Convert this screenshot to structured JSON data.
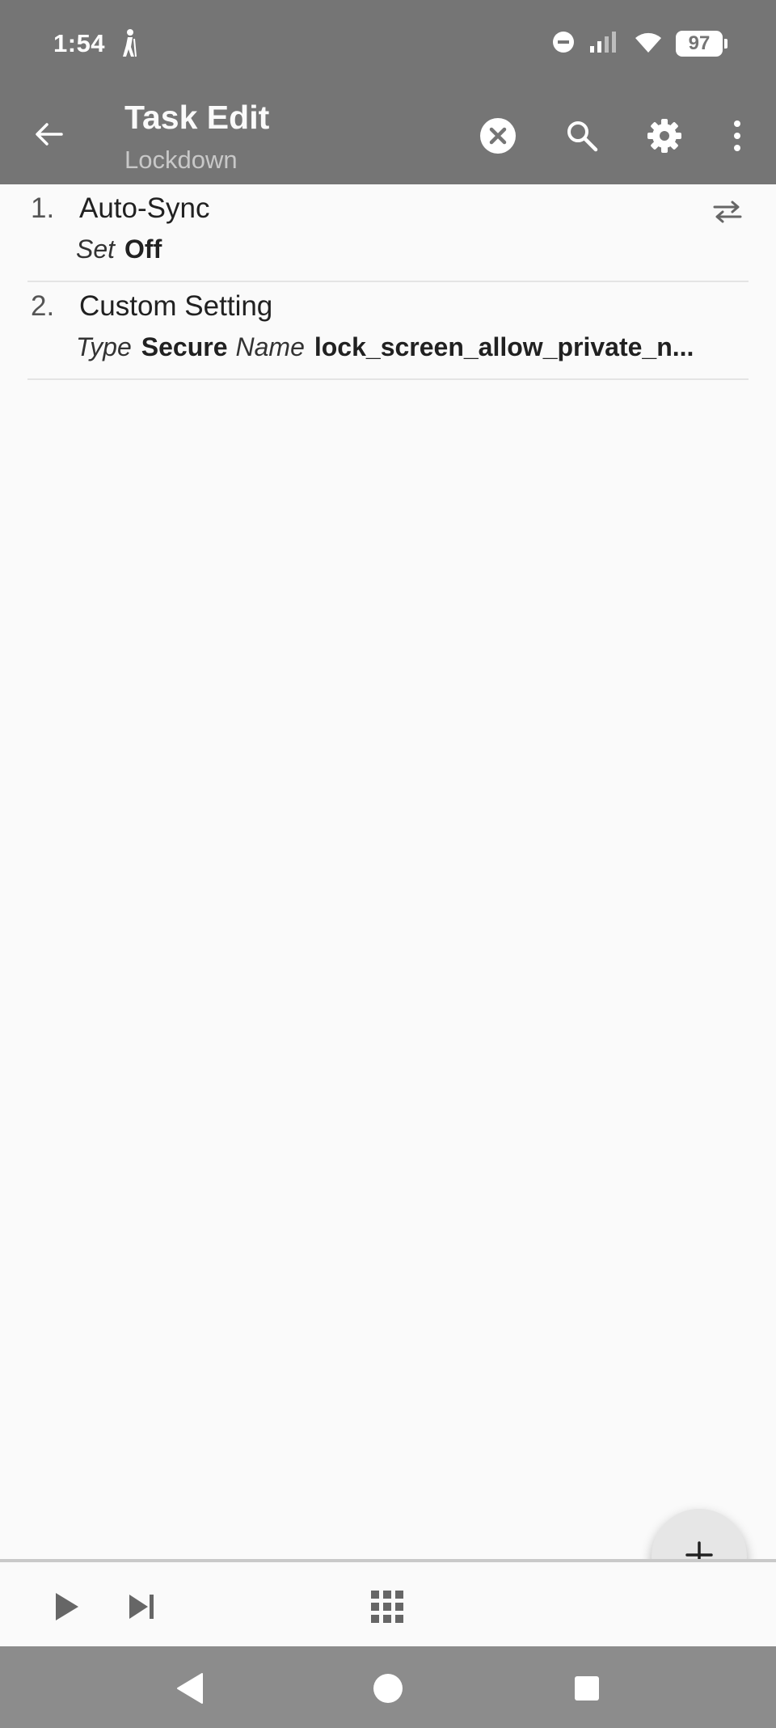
{
  "status_bar": {
    "time": "1:54",
    "battery": "97",
    "icons": [
      "hiker-icon",
      "dnd-icon",
      "signal-icon",
      "wifi-icon",
      "battery-icon"
    ]
  },
  "toolbar": {
    "title": "Task Edit",
    "subtitle": "Lockdown",
    "icons": [
      "back-arrow-icon",
      "close-circle-icon",
      "search-icon",
      "gear-icon",
      "more-vert-icon"
    ]
  },
  "actions": [
    {
      "number": "1.",
      "name": "Auto-Sync",
      "params": [
        {
          "key": "Set",
          "value": "Off"
        }
      ]
    },
    {
      "number": "2.",
      "name": "Custom Setting",
      "params": [
        {
          "key": "Type",
          "value": "Secure"
        },
        {
          "key": "Name",
          "value": "lock_screen_allow_private_n..."
        }
      ]
    }
  ],
  "bottom_bar": {
    "icons": [
      "play-icon",
      "skip-next-icon",
      "grid-icon"
    ],
    "fab": "plus-icon"
  },
  "nav_bar": {
    "icons": [
      "nav-back-icon",
      "nav-home-icon",
      "nav-recents-icon"
    ]
  },
  "colors": {
    "toolbar_bg": "#757575",
    "page_bg": "#fafafa",
    "nav_bg": "#8c8c8c",
    "fab_bg": "#e6e6e6"
  }
}
